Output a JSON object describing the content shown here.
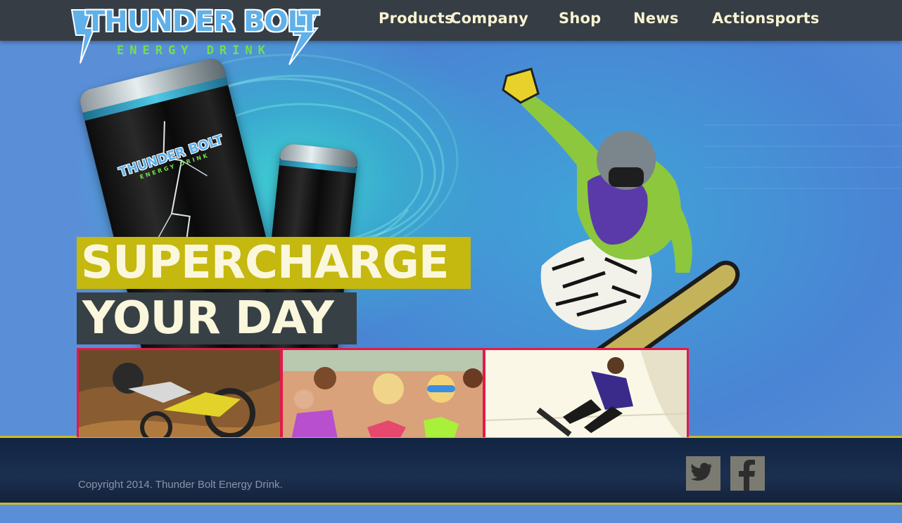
{
  "brand": {
    "name": "THUNDER BOLT",
    "tagline": "ENERGY DRINK",
    "can_name": "THUNDER BOLT",
    "can_tagline": "ENERGY DRINK"
  },
  "nav": {
    "items": [
      {
        "label": "Products"
      },
      {
        "label": "Company"
      },
      {
        "label": "Shop"
      },
      {
        "label": "News"
      },
      {
        "label": "Actionsports"
      }
    ]
  },
  "hero": {
    "headline_line1": "SUPERCHARGE",
    "headline_line2": "YOUR DAY",
    "thumbnails": [
      {
        "subject": "motocross rider"
      },
      {
        "subject": "beach party crowd"
      },
      {
        "subject": "skateboarder on ramp"
      }
    ]
  },
  "footer": {
    "copyright": "Copyright 2014. Thunder Bolt Energy Drink.",
    "social": [
      {
        "icon": "twitter-icon"
      },
      {
        "icon": "facebook-icon"
      }
    ]
  },
  "colors": {
    "nav_bg": "#363d44",
    "nav_text": "#f7f2d2",
    "headline_yellow": "#c5b80f",
    "headline_dark": "#374045",
    "thumb_border": "#e21a4a",
    "footer_bg": "#1b2f50",
    "footer_rule": "#c9bb2a",
    "logo_blue": "#5fb1ea",
    "logo_green": "#72e04a"
  }
}
